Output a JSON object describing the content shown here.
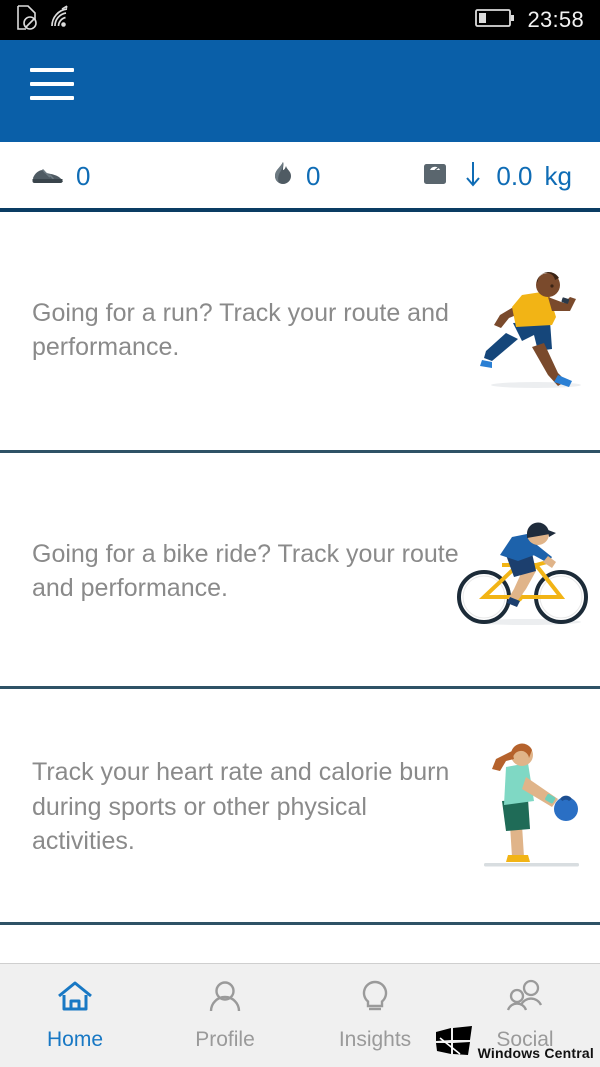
{
  "statusbar": {
    "icons": [
      "no-sim-icon",
      "wifi-icon",
      "battery-icon"
    ],
    "time": "23:58"
  },
  "appbar": {
    "menu_label": "menu",
    "bg_color": "#0a5fa8"
  },
  "stats": {
    "accent_color": "#0f6cb5",
    "items": [
      {
        "icon": "running-shoe-icon",
        "value": "0",
        "unit": ""
      },
      {
        "icon": "flame-icon",
        "value": "0",
        "unit": ""
      },
      {
        "icon": "weight-scale-icon",
        "trend": "down-arrow-icon",
        "value": "0.0",
        "unit": "kg"
      }
    ]
  },
  "cards": [
    {
      "text": "Going for a run? Track your route and performance.",
      "art": "runner-illustration"
    },
    {
      "text": "Going for a bike ride? Track your route and performance.",
      "art": "cyclist-illustration"
    },
    {
      "text": "Track your heart rate and calorie burn during sports or other physical activities.",
      "art": "kettlebell-woman-illustration"
    }
  ],
  "navbar": {
    "active_color": "#1878c4",
    "inactive_color": "#9a9a9a",
    "items": [
      {
        "label": "Home",
        "icon": "home-icon",
        "active": true
      },
      {
        "label": "Profile",
        "icon": "person-icon",
        "active": false
      },
      {
        "label": "Insights",
        "icon": "lightbulb-icon",
        "active": false
      },
      {
        "label": "Social",
        "icon": "people-icon",
        "active": false
      }
    ]
  },
  "watermark": {
    "text": "Windows Central",
    "icon": "windows-logo-icon"
  }
}
